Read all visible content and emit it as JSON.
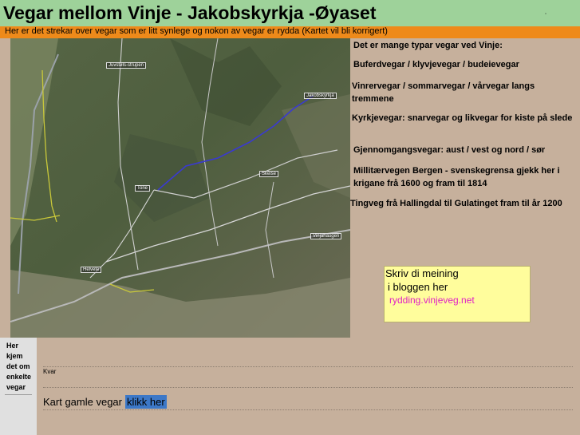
{
  "header": {
    "title": "Vegar mellom Vinje - Jakobskyrkja -Øyaset",
    "subtitle": "Her er det strekar over vegar som er litt synlege og nokon av vegar er rydda  (Kartet vil bli korrigert)"
  },
  "map": {
    "labels": [
      {
        "id": "juvstolsstrupen",
        "text": "Juvstøls-strupen"
      },
      {
        "id": "jakobskyrkja",
        "text": "Jakobskyrkja"
      },
      {
        "id": "skeise",
        "text": "Skeise"
      },
      {
        "id": "tone",
        "text": "Tone"
      },
      {
        "id": "vinjahaugen",
        "text": "Vinjahaugen"
      },
      {
        "id": "helvete",
        "text": "Helvete"
      }
    ]
  },
  "road_types": [
    "Det er mange typar vegar ved Vinje:",
    "Buferdvegar / klyvjevegar / budeievegar",
    "Vinrervegar / sommarvegar / vårvegar langs tremmene",
    "Kyrkjevegar:  snarvegar og likvegar for kiste på slede",
    "Gjennomgangsvegar: aust / vest og nord / sør",
    "Millitærvegen Bergen - svenskegrensa gjekk her i krigane frå 1600 og fram til 1814",
    "Tingveg frå Hallingdal til Gulatinget fram til år 1200"
  ],
  "blog_box": {
    "line1": "Skriv di meining",
    "line2": "i bloggen her",
    "link": "rydding.vinjeveg.net"
  },
  "side_panel": {
    "text_lines": [
      "Her",
      "kjem",
      "det om",
      "enkelte",
      "vegar"
    ]
  },
  "bottom": {
    "kvar": "Kvar",
    "kart_label": "Kart gamle vegar",
    "kart_link": "klikk her"
  }
}
